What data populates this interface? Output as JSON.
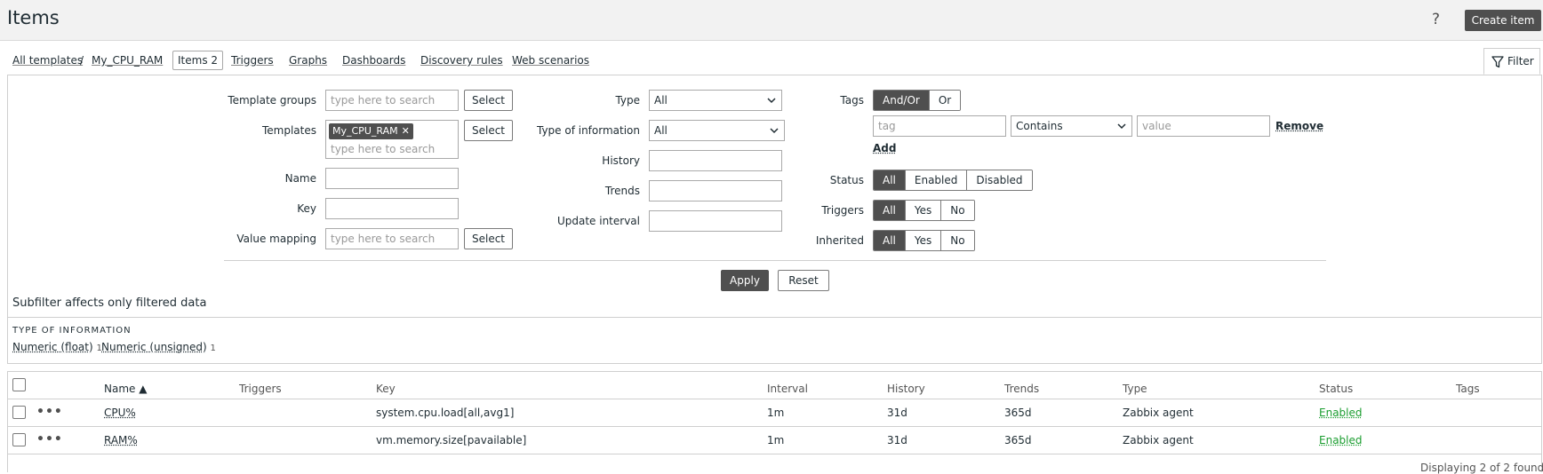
{
  "header": {
    "title": "Items",
    "help_label": "?",
    "create_label": "Create item"
  },
  "nav": {
    "all_templates": "All templates",
    "separator": "/",
    "template": "My_CPU_RAM",
    "items_tab": "Items 2",
    "triggers": "Triggers",
    "graphs": "Graphs",
    "dashboards": "Dashboards",
    "discovery": "Discovery rules",
    "web": "Web scenarios"
  },
  "filter": {
    "tab_label": "Filter",
    "template_groups_label": "Template groups",
    "template_groups_placeholder": "type here to search",
    "templates_label": "Templates",
    "templates_chip": "My_CPU_RAM",
    "templates_placeholder": "type here to search",
    "name_label": "Name",
    "name_value": "",
    "key_label": "Key",
    "key_value": "",
    "value_mapping_label": "Value mapping",
    "value_mapping_placeholder": "type here to search",
    "select_label": "Select",
    "type_label": "Type",
    "type_value": "All",
    "type_info_label": "Type of information",
    "type_info_value": "All",
    "history_label": "History",
    "trends_label": "Trends",
    "update_interval_label": "Update interval",
    "tags_label": "Tags",
    "tags_andor": "And/Or",
    "tags_or": "Or",
    "tag_placeholder": "tag",
    "tag_operator": "Contains",
    "value_placeholder": "value",
    "remove_label": "Remove",
    "add_label": "Add",
    "status_label": "Status",
    "status_options": [
      "All",
      "Enabled",
      "Disabled"
    ],
    "triggers_label": "Triggers",
    "triggers_options": [
      "All",
      "Yes",
      "No"
    ],
    "inherited_label": "Inherited",
    "inherited_options": [
      "All",
      "Yes",
      "No"
    ],
    "apply_label": "Apply",
    "reset_label": "Reset"
  },
  "subfilter": {
    "title": "Subfilter affects only filtered data",
    "type_info_title": "TYPE OF INFORMATION",
    "items": [
      {
        "label": "Numeric (float)",
        "count": "1"
      },
      {
        "label": "Numeric (unsigned)",
        "count": "1"
      }
    ]
  },
  "table": {
    "columns": {
      "name": "Name ▲",
      "triggers": "Triggers",
      "key": "Key",
      "interval": "Interval",
      "history": "History",
      "trends": "Trends",
      "type": "Type",
      "status": "Status",
      "tags": "Tags"
    },
    "rows": [
      {
        "name": "CPU%",
        "key": "system.cpu.load[all,avg1]",
        "interval": "1m",
        "history": "31d",
        "trends": "365d",
        "type": "Zabbix agent",
        "status": "Enabled"
      },
      {
        "name": "RAM%",
        "key": "vm.memory.size[pavailable]",
        "interval": "1m",
        "history": "31d",
        "trends": "365d",
        "type": "Zabbix agent",
        "status": "Enabled"
      }
    ],
    "footer": "Displaying 2 of 2 found"
  },
  "colors": {
    "dark_button": "#4f4f4f",
    "enabled_status": "#1a9d2f"
  }
}
